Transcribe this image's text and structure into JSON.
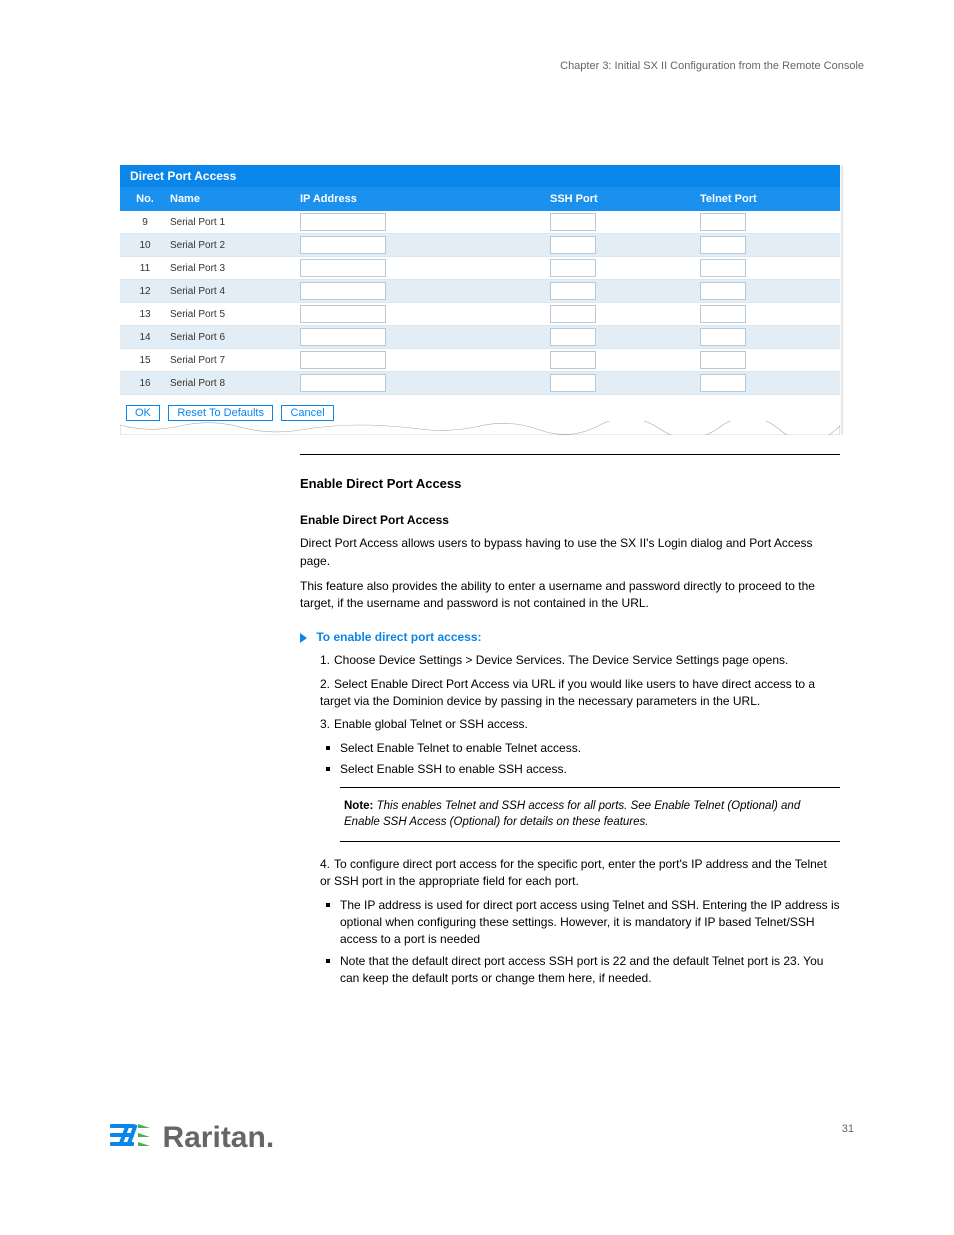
{
  "topHeader": "Chapter 3: Initial SX II Configuration from the Remote Console",
  "panel": {
    "title": "Direct Port Access",
    "headers": {
      "no": "No.",
      "name": "Name",
      "ip": "IP Address",
      "ssh": "SSH Port",
      "telnet": "Telnet Port"
    },
    "rows": [
      {
        "no": "9",
        "name": "Serial Port 1"
      },
      {
        "no": "10",
        "name": "Serial Port 2"
      },
      {
        "no": "11",
        "name": "Serial Port 3"
      },
      {
        "no": "12",
        "name": "Serial Port 4"
      },
      {
        "no": "13",
        "name": "Serial Port 5"
      },
      {
        "no": "14",
        "name": "Serial Port 6"
      },
      {
        "no": "15",
        "name": "Serial Port 7"
      },
      {
        "no": "16",
        "name": "Serial Port 8"
      }
    ],
    "buttons": {
      "ok": "OK",
      "reset": "Reset To Defaults",
      "cancel": "Cancel"
    }
  },
  "body": {
    "section_heading": "Enable Direct Port Access",
    "section_sub": "Enable Direct Port Access",
    "para1": "Direct Port Access allows users to bypass having to use the SX II's Login dialog and Port Access page.",
    "para2": "This feature also provides the ability to enter a username and password directly to proceed to the target, if the username and password is not contained in the URL.",
    "proc_head": "To enable direct port access:",
    "step1": "Choose Device Settings > Device Services. The Device Service Settings page opens.",
    "step2": "Select Enable Direct Port Access via URL if you would like users to have direct access to a target via the Dominion device by passing in the necessary parameters in the URL.",
    "step3": "Enable global Telnet or SSH access.",
    "bul1": "Select Enable Telnet to enable Telnet access.",
    "bul2": "Select Enable SSH to enable SSH access.",
    "note": "This enables Telnet and SSH access for all ports. See Enable Telnet (Optional) and Enable SSH Access (Optional) for details on these features.",
    "step4_a": "To configure direct port access for the specific port, enter the port's IP address and the Telnet or SSH port in the appropriate field for each port.",
    "bul4a": "The IP address is used for direct port access using Telnet and SSH. Entering the IP address is optional when configuring these settings. However, it is mandatory if IP based Telnet/SSH access to a port is needed",
    "bul4b": "Note that the default direct port access SSH port is 22 and the default Telnet port is 23. You can keep the default ports or change them here, if needed.",
    "noteLabel": "Note:"
  },
  "pageNumber": "31",
  "logoText": "Raritan."
}
